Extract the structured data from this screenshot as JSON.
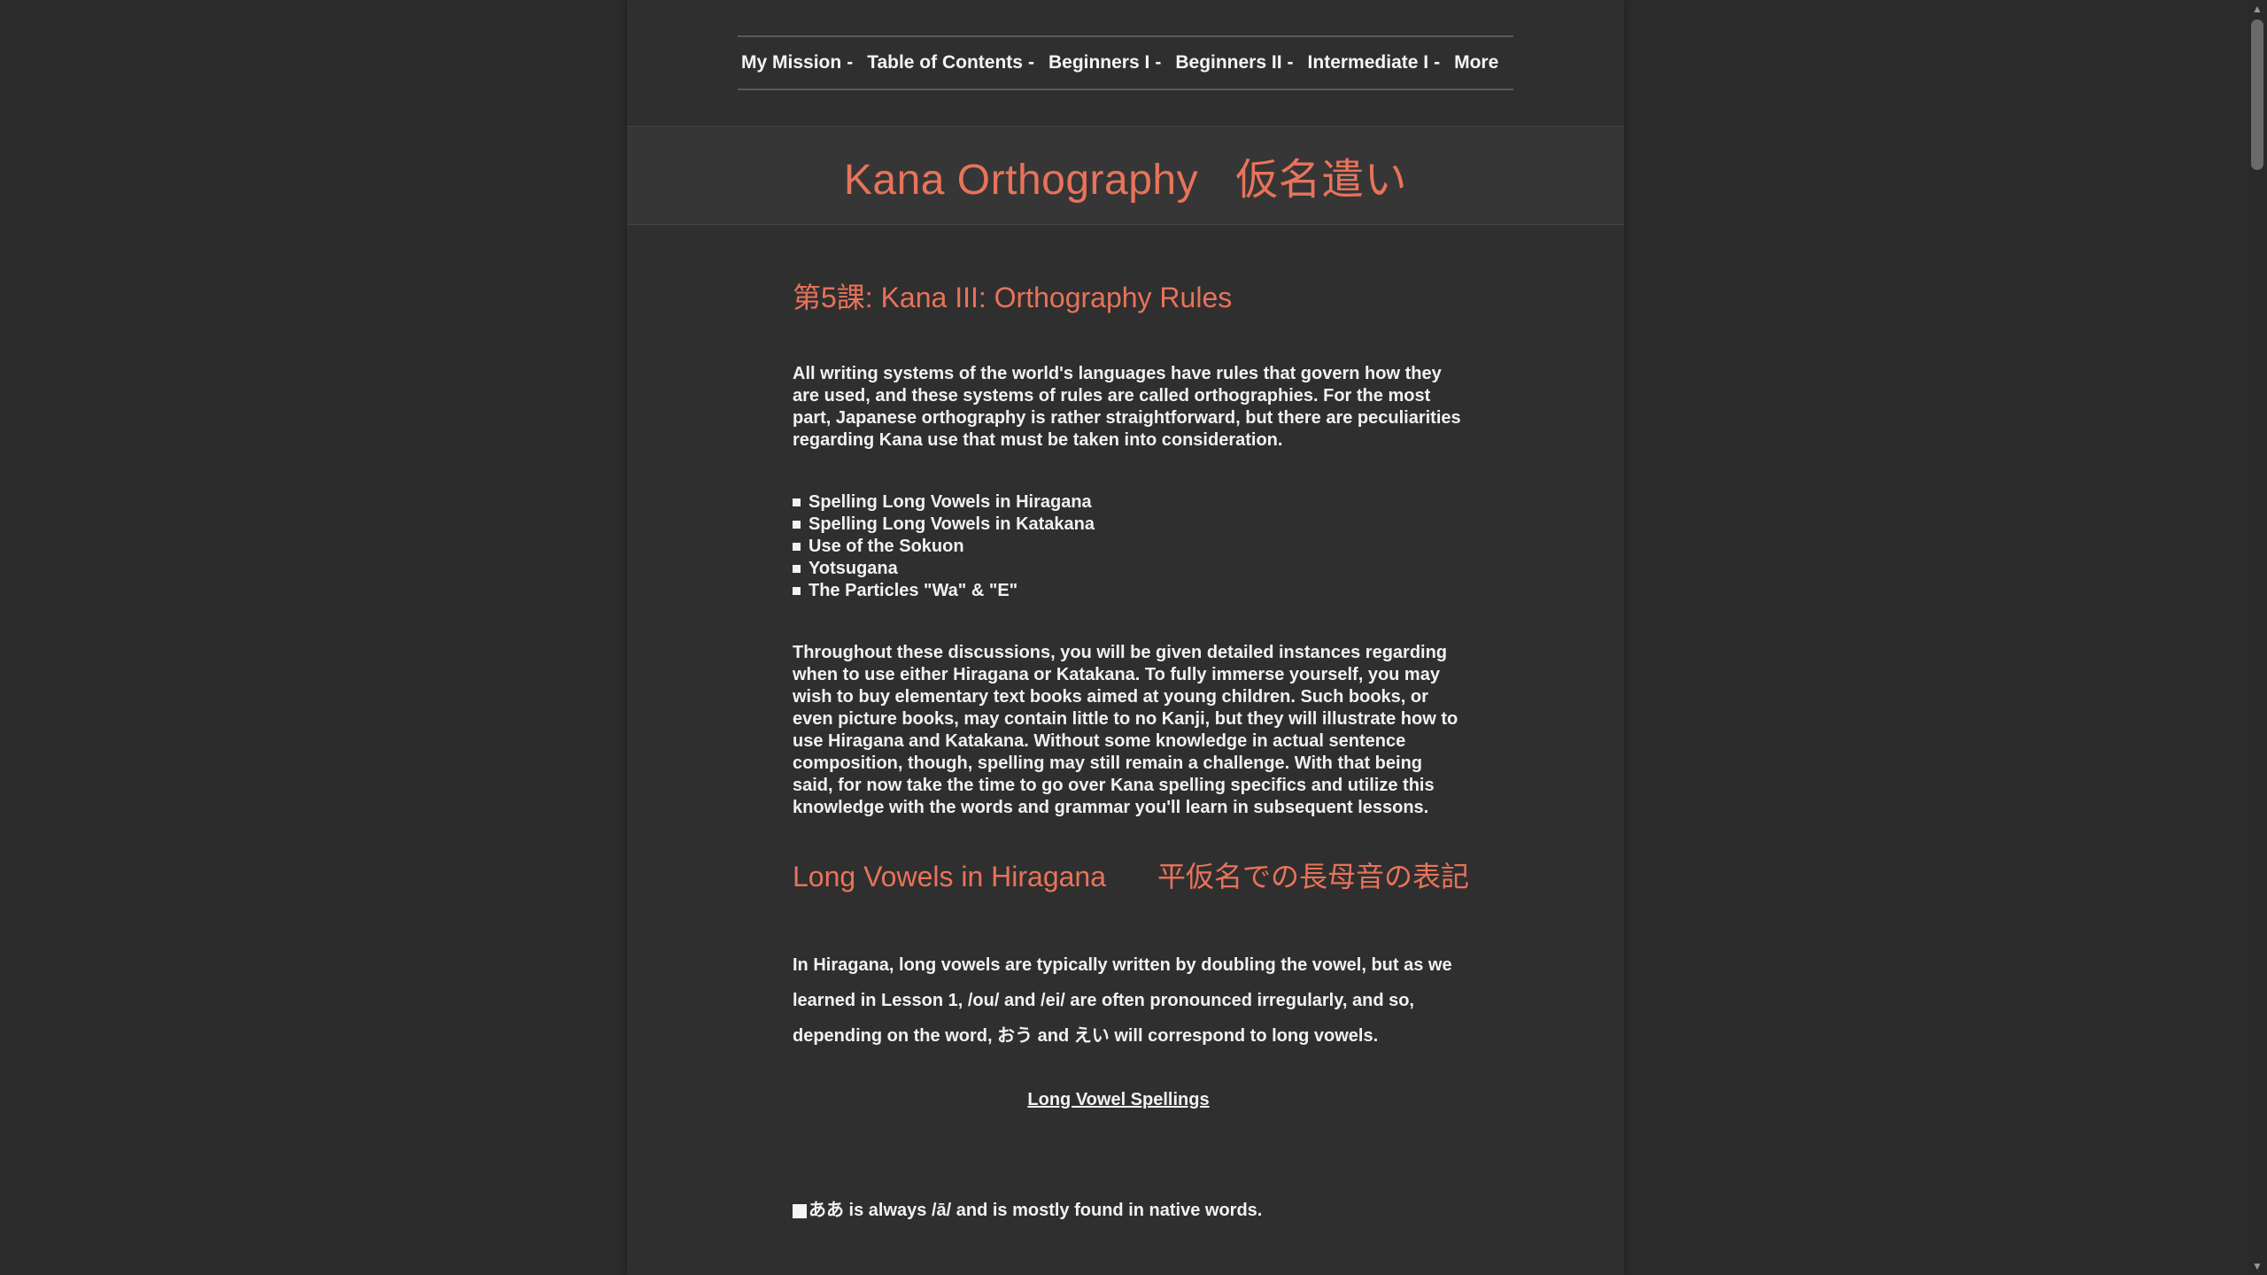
{
  "nav": {
    "items": [
      {
        "label": "My Mission",
        "sep": "-"
      },
      {
        "label": "Table of Contents",
        "sep": "-"
      },
      {
        "label": "Beginners I",
        "sep": "-"
      },
      {
        "label": "Beginners II",
        "sep": "-"
      },
      {
        "label": "Intermediate I",
        "sep": "-"
      },
      {
        "label": "More",
        "sep": ""
      }
    ]
  },
  "header": {
    "title_en": "Kana Orthography",
    "title_jp": "仮名遣い"
  },
  "lesson": {
    "title": "第5課: Kana III: Orthography Rules",
    "intro": "All writing systems of the world's languages have rules that govern how they are used, and these systems of rules are called orthographies. For the most part, Japanese orthography is rather straightforward, but there are peculiarities regarding Kana use that must be taken into consideration.",
    "topics": [
      "Spelling Long Vowels in Hiragana",
      "Spelling Long Vowels in Katakana",
      "Use of the Sokuon",
      "Yotsugana",
      "The Particles \"Wa\" & \"E\""
    ],
    "para2": "Throughout these discussions, you will be given detailed instances regarding when to use either Hiragana or Katakana. To fully immerse yourself, you may wish to buy elementary text books aimed at young children. Such books, or even picture books, may contain little to no Kanji, but they will illustrate how to use Hiragana and Katakana. Without some knowledge in actual sentence composition, though, spelling may still remain a challenge. With that being said, for now take the time to go over Kana spelling specifics and utilize this knowledge with the words and grammar you'll learn in subsequent lessons."
  },
  "section": {
    "title_en": "Long Vowels in Hiragana",
    "title_jp": "平仮名での長母音の表記",
    "para": "In Hiragana, long vowels are typically written by doubling the vowel, but as we learned in Lesson 1, /ou/ and /ei/ are often pronounced irregularly, and so, depending on the word, おう and えい will correspond to long vowels.",
    "subheading": "Long Vowel Spellings",
    "first_item": "ああ is always /ā/ and is mostly found in native words."
  },
  "colors": {
    "accent": "#e8735a",
    "background": "#2b2b2b",
    "page": "#2f2f2f",
    "text": "#f2f2f2"
  }
}
